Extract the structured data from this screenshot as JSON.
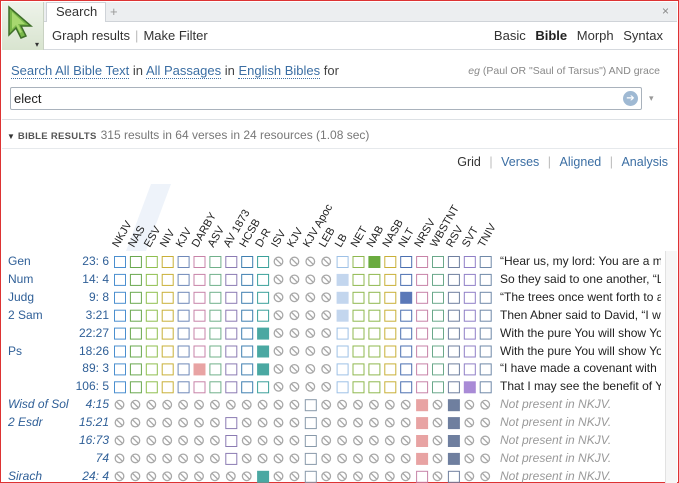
{
  "app": {
    "tab_label": "Search",
    "tab_add": "+",
    "tab_close": "×",
    "logo_caret": "▾"
  },
  "toolbar": {
    "graph_results": "Graph results",
    "separator": "|",
    "make_filter": "Make Filter",
    "modes": [
      "Basic",
      "Bible",
      "Morph",
      "Syntax"
    ],
    "active_mode": "Bible"
  },
  "query": {
    "prefix": "Search",
    "scope": "All Bible Text",
    "in1": "in",
    "passages": "All Passages",
    "in2": "in",
    "collection": "English Bibles",
    "for": "for",
    "hint_eg": "eg",
    "hint_text": "(Paul OR \"Saul of Tarsus\") AND grace",
    "value": "elect",
    "go_icon": "➔",
    "dropdown_caret": "▾"
  },
  "results": {
    "collapse_icon": "▼",
    "label": "BIBLE RESULTS",
    "summary": "315 results in 64 verses in 24 resources (1.08 sec)",
    "views": [
      "Grid",
      "Verses",
      "Aligned",
      "Analysis"
    ],
    "active_view": "Grid",
    "view_separator": "|"
  },
  "columns": [
    "NKJV",
    "NAS",
    "ESV",
    "NIV",
    "KJV",
    "DARBY",
    "ASV",
    "AV 1873",
    "HCSB",
    "D-R",
    "ISV",
    "KJV",
    "KJV Apoc",
    "LEB",
    "LB",
    "NET",
    "NAB",
    "NASB",
    "NLT",
    "NRSV",
    "WBSTNT",
    "RSV",
    "SVT",
    "TNIV"
  ],
  "column_colors": {
    "NKJV": "#4b8fcf",
    "NAS": "#6aa84f",
    "ESV": "#8fbf4f",
    "NIV": "#c9b038",
    "KJV": "#6f88b8",
    "DARBY": "#c783a8",
    "ASV": "#70b08a",
    "AV 1873": "#8b7bb3",
    "HCSB": "#3f7fb0",
    "D-R": "#3aa09a",
    "LEB": "#6f8fc0",
    "LB": "#9ec1e6",
    "NET": "#8fb84f",
    "NAB": "#8fb84f",
    "NASB": "#c9b038",
    "NLT": "#4b6fb0",
    "NRSV": "#c783a8",
    "WBSTNT": "#6aa88a",
    "RSV": "#6f7f9f",
    "SVT": "#8f7fc6",
    "TNIV": "#6f88a8"
  },
  "rows": [
    {
      "book": "Gen",
      "ref": "23:  6",
      "italic": false,
      "text": "“Hear us, my lord: You are a m",
      "cells": [
        "o",
        "o",
        "o",
        "o",
        "o",
        "o",
        "o",
        "o",
        "o",
        "o",
        "x",
        "x",
        "x",
        "x",
        "o",
        "o",
        "F:#6aab3f",
        "o",
        "o",
        "o",
        "o",
        "o",
        "o",
        "o"
      ]
    },
    {
      "book": "Num",
      "ref": "14:  4",
      "italic": false,
      "text": "So they said to one another, “L",
      "cells": [
        "o",
        "o",
        "o",
        "o",
        "o",
        "o",
        "o",
        "o",
        "o",
        "o",
        "x",
        "x",
        "x",
        "x",
        "F:#c3d6ee",
        "o",
        "o",
        "o",
        "o",
        "o",
        "o",
        "o",
        "o",
        "o"
      ]
    },
    {
      "book": "Judg",
      "ref": "9:  8",
      "italic": false,
      "text": "“The trees once went forth to a",
      "cells": [
        "o",
        "o",
        "o",
        "o",
        "o",
        "o",
        "o",
        "o",
        "o",
        "o",
        "x",
        "x",
        "x",
        "x",
        "F:#c3d6ee",
        "o",
        "o",
        "o",
        "F:#5a78b8",
        "o",
        "o",
        "o",
        "o",
        "o"
      ]
    },
    {
      "book": "2 Sam",
      "ref": "3:21",
      "italic": false,
      "text": "Then Abner said to David, “I w",
      "cells": [
        "o",
        "o",
        "o",
        "o",
        "o",
        "o",
        "o",
        "o",
        "o",
        "o",
        "x",
        "x",
        "x",
        "x",
        "F:#c3d6ee",
        "o",
        "o",
        "o",
        "o",
        "o",
        "o",
        "o",
        "o",
        "o"
      ]
    },
    {
      "book": "",
      "ref": "22:27",
      "italic": false,
      "text": "With the pure You will show Yo",
      "cells": [
        "o",
        "o",
        "o",
        "o",
        "o",
        "o",
        "o",
        "o",
        "o",
        "F:#4aa8a2",
        "x",
        "x",
        "x",
        "x",
        "o",
        "o",
        "o",
        "o",
        "o",
        "o",
        "o",
        "o",
        "o",
        "o"
      ]
    },
    {
      "book": "Ps",
      "ref": "18:26",
      "italic": false,
      "text": "With the pure You will show Yo",
      "cells": [
        "o",
        "o",
        "o",
        "o",
        "o",
        "o",
        "o",
        "o",
        "o",
        "F:#4aa8a2",
        "x",
        "x",
        "x",
        "x",
        "o",
        "o",
        "o",
        "o",
        "o",
        "o",
        "o",
        "o",
        "o",
        "o"
      ]
    },
    {
      "book": "",
      "ref": "89:  3",
      "italic": false,
      "text": "“I have made a covenant with M",
      "cells": [
        "o",
        "o",
        "o",
        "o",
        "o",
        "F:#e8a3a3",
        "o",
        "o",
        "o",
        "F:#4aa8a2",
        "x",
        "x",
        "x",
        "x",
        "o",
        "o",
        "o",
        "o",
        "o",
        "o",
        "o",
        "o",
        "o",
        "o"
      ]
    },
    {
      "book": "",
      "ref": "106:  5",
      "italic": false,
      "text": "That I may see the benefit of Y",
      "cells": [
        "o",
        "o",
        "o",
        "o",
        "o",
        "o",
        "o",
        "o",
        "o",
        "o",
        "x",
        "x",
        "x",
        "x",
        "o",
        "o",
        "o",
        "o",
        "o",
        "o",
        "o",
        "o",
        "F:#a98bd6",
        "o"
      ]
    },
    {
      "book": "Wisd of Sol",
      "ref": "4:15",
      "italic": true,
      "text": "Not present in NKJV.",
      "cells": [
        "x",
        "x",
        "x",
        "x",
        "x",
        "x",
        "x",
        "x",
        "x",
        "x",
        "x",
        "x",
        "o",
        "x",
        "x",
        "x",
        "x",
        "x",
        "x",
        "F:#e8a3a3",
        "x",
        "F:#6f7f9f",
        "x",
        "x"
      ]
    },
    {
      "book": "2 Esdr",
      "ref": "15:21",
      "italic": true,
      "text": "Not present in NKJV.",
      "cells": [
        "x",
        "x",
        "x",
        "x",
        "x",
        "x",
        "x",
        "o",
        "x",
        "x",
        "x",
        "x",
        "o",
        "x",
        "x",
        "x",
        "x",
        "x",
        "x",
        "F:#e8a3a3",
        "x",
        "F:#6f7f9f",
        "x",
        "x"
      ]
    },
    {
      "book": "",
      "ref": "16:73",
      "italic": true,
      "text": "Not present in NKJV.",
      "cells": [
        "x",
        "x",
        "x",
        "x",
        "x",
        "x",
        "x",
        "o",
        "x",
        "x",
        "x",
        "x",
        "o",
        "x",
        "x",
        "x",
        "x",
        "x",
        "x",
        "F:#e8a3a3",
        "x",
        "F:#6f7f9f",
        "x",
        "x"
      ]
    },
    {
      "book": "",
      "ref": "74",
      "italic": true,
      "text": "Not present in NKJV.",
      "cells": [
        "x",
        "x",
        "x",
        "x",
        "x",
        "x",
        "x",
        "o",
        "x",
        "x",
        "x",
        "x",
        "o",
        "x",
        "x",
        "x",
        "x",
        "x",
        "x",
        "F:#e8a3a3",
        "x",
        "F:#6f7f9f",
        "x",
        "x"
      ]
    },
    {
      "book": "Sirach",
      "ref": "24:  4",
      "italic": true,
      "text": "Not present in NKJV.",
      "cells": [
        "x",
        "x",
        "x",
        "x",
        "x",
        "x",
        "x",
        "x",
        "x",
        "F:#4aa8a2",
        "x",
        "x",
        "o",
        "x",
        "x",
        "x",
        "x",
        "x",
        "x",
        "o",
        "x",
        "o",
        "x",
        "x"
      ]
    }
  ]
}
